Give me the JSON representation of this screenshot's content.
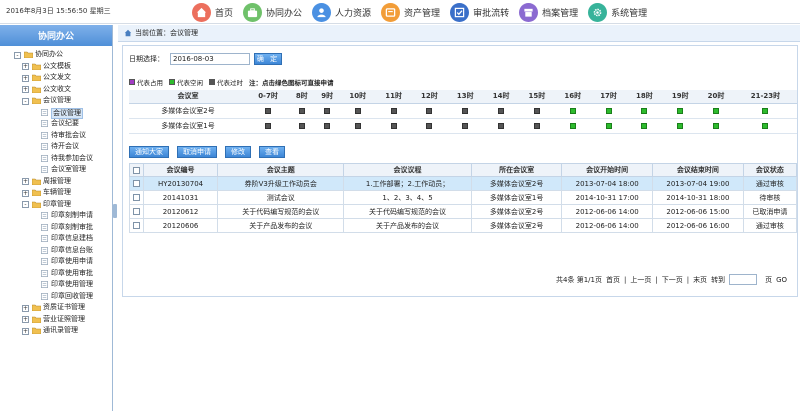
{
  "topbar": {
    "datetime": "2016年8月3日 15:56:50 星期三",
    "nav": [
      {
        "label": "首页",
        "icon": "home-icon",
        "color": "#ec6f5d"
      },
      {
        "label": "协同办公",
        "icon": "briefcase-icon",
        "color": "#6fc16a"
      },
      {
        "label": "人力资源",
        "icon": "person-icon",
        "color": "#4a90e2"
      },
      {
        "label": "资产管理",
        "icon": "asset-icon",
        "color": "#f29d38"
      },
      {
        "label": "审批流转",
        "icon": "approval-icon",
        "color": "#3a6fc9"
      },
      {
        "label": "档案管理",
        "icon": "archive-icon",
        "color": "#8b6ad1"
      },
      {
        "label": "系统管理",
        "icon": "gear-icon",
        "color": "#37b39a"
      }
    ]
  },
  "sidebar": {
    "title": "协同办公",
    "tree": [
      {
        "label": "协同办公",
        "level": 0,
        "exp": "-",
        "icon": "folder"
      },
      {
        "label": "公文模板",
        "level": 1,
        "exp": "+",
        "icon": "folder"
      },
      {
        "label": "公文发文",
        "level": 1,
        "exp": "+",
        "icon": "folder"
      },
      {
        "label": "公文收文",
        "level": 1,
        "exp": "+",
        "icon": "folder"
      },
      {
        "label": "会议管理",
        "level": 1,
        "exp": "-",
        "icon": "folder"
      },
      {
        "label": "会议管理",
        "level": 2,
        "icon": "doc",
        "selected": true
      },
      {
        "label": "会议纪要",
        "level": 2,
        "icon": "doc"
      },
      {
        "label": "待审批会议",
        "level": 2,
        "icon": "doc"
      },
      {
        "label": "待开会议",
        "level": 2,
        "icon": "doc"
      },
      {
        "label": "待我参加会议",
        "level": 2,
        "icon": "doc"
      },
      {
        "label": "会议室管理",
        "level": 2,
        "icon": "doc"
      },
      {
        "label": "周报管理",
        "level": 1,
        "exp": "+",
        "icon": "folder"
      },
      {
        "label": "车辆管理",
        "level": 1,
        "exp": "+",
        "icon": "folder"
      },
      {
        "label": "印章管理",
        "level": 1,
        "exp": "-",
        "icon": "folder"
      },
      {
        "label": "印章刻制申请",
        "level": 2,
        "icon": "doc"
      },
      {
        "label": "印章刻制审批",
        "level": 2,
        "icon": "doc"
      },
      {
        "label": "印章信息建档",
        "level": 2,
        "icon": "doc"
      },
      {
        "label": "印章信息台账",
        "level": 2,
        "icon": "doc"
      },
      {
        "label": "印章使用申请",
        "level": 2,
        "icon": "doc"
      },
      {
        "label": "印章使用审批",
        "level": 2,
        "icon": "doc"
      },
      {
        "label": "印章使用管理",
        "level": 2,
        "icon": "doc"
      },
      {
        "label": "印章回收管理",
        "level": 2,
        "icon": "doc"
      },
      {
        "label": "资质证书管理",
        "level": 1,
        "exp": "+",
        "icon": "folder"
      },
      {
        "label": "营业证照管理",
        "level": 1,
        "exp": "+",
        "icon": "folder"
      },
      {
        "label": "通讯录管理",
        "level": 1,
        "exp": "+",
        "icon": "folder"
      }
    ]
  },
  "breadcrumb": {
    "prefix": "当前位置：",
    "current": "会议管理"
  },
  "date_filter": {
    "label": "日期选择：",
    "value": "2016-08-03",
    "button": "确 定"
  },
  "legend": {
    "occupied": "代表占用",
    "free": "代表空闲",
    "past": "代表过时",
    "tip": "注：点击绿色图标可直接申请",
    "colors": {
      "occupied": "#a23cc4",
      "free": "#2dbb2d",
      "past": "#555555"
    }
  },
  "schedule": {
    "room_header": "会议室",
    "slots": [
      "0-7时",
      "8时",
      "9时",
      "10时",
      "11时",
      "12时",
      "13时",
      "14时",
      "15时",
      "16时",
      "17时",
      "18时",
      "19时",
      "20时",
      "21-23时"
    ],
    "rooms": [
      {
        "name": "多媒体会议室2号",
        "status": [
          "past",
          "past",
          "past",
          "past",
          "past",
          "past",
          "past",
          "past",
          "past",
          "free",
          "free",
          "free",
          "free",
          "free",
          "free"
        ]
      },
      {
        "name": "多媒体会议室1号",
        "status": [
          "past",
          "past",
          "past",
          "past",
          "past",
          "past",
          "past",
          "past",
          "past",
          "free",
          "free",
          "free",
          "free",
          "free",
          "free"
        ]
      }
    ]
  },
  "actions": [
    "通知大家",
    "取消申请",
    "修改",
    "查看"
  ],
  "meetings": {
    "headers": [
      "会议编号",
      "会议主题",
      "会议议程",
      "所在会议室",
      "会议开始时间",
      "会议结束时间",
      "会议状态"
    ],
    "rows": [
      [
        "HY20130704",
        "券阶V3升级工作动员会",
        "1.工作部署；2.工作动员；",
        "多媒体会议室2号",
        "2013-07-04 18:00",
        "2013-07-04 19:00",
        "通过审核"
      ],
      [
        "20141031",
        "测试会议",
        "1、2、3、4、5",
        "多媒体会议室1号",
        "2014-10-31 17:00",
        "2014-10-31 18:00",
        "待审核"
      ],
      [
        "20120612",
        "关于代码编写规范的会议",
        "关于代码编写规范的会议",
        "多媒体会议室2号",
        "2012-06-06 14:00",
        "2012-06-06 15:00",
        "已取消申请"
      ],
      [
        "20120606",
        "关于产品发布的会议",
        "关于产品发布的会议",
        "多媒体会议室2号",
        "2012-06-06 14:00",
        "2012-06-06 16:00",
        "通过审核"
      ]
    ]
  },
  "pager": {
    "summary": "共4条 第1/1页",
    "first": "首页",
    "prev": "上一页",
    "next": "下一页",
    "last": "末页",
    "goto": "转到",
    "page_unit": "页",
    "go": "GO"
  }
}
